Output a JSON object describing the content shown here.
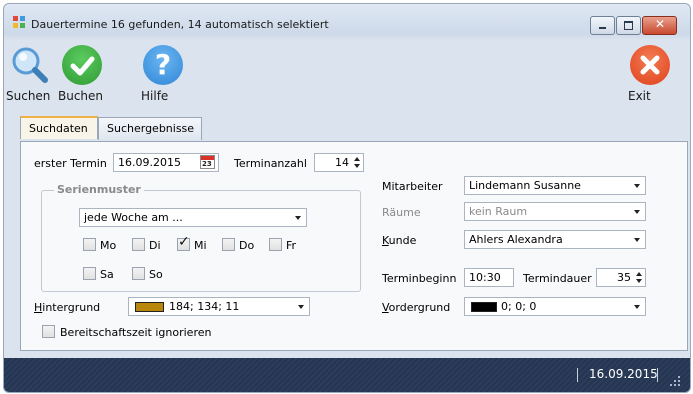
{
  "window": {
    "title": "Dauertermine 16 gefunden, 14 automatisch selektiert"
  },
  "toolbar": {
    "search_label": "Suchen",
    "book_label": "Buchen",
    "help_label": "Hilfe",
    "exit_label": "Exit"
  },
  "tabs": [
    {
      "label": "Suchdaten"
    },
    {
      "label": "Suchergebnisse"
    }
  ],
  "form": {
    "first_date_label": "erster Termin",
    "first_date_value": "16.09.2015",
    "count_label": "Terminanzahl",
    "count_value": "14",
    "series_group_title": "Serienmuster",
    "series_value": "jede Woche am ...",
    "weekdays": [
      {
        "label": "Mo",
        "checked": false
      },
      {
        "label": "Di",
        "checked": false
      },
      {
        "label": "Mi",
        "checked": true
      },
      {
        "label": "Do",
        "checked": false
      },
      {
        "label": "Fr",
        "checked": false
      },
      {
        "label": "Sa",
        "checked": false
      },
      {
        "label": "So",
        "checked": false
      }
    ],
    "background_label_first": "H",
    "background_label_rest": "intergrund",
    "background_value": "184; 134; 11",
    "background_color": "#b8860b",
    "ignore_label": "Bereitschaftszeit ignorieren",
    "employee_label": "Mitarbeiter",
    "employee_value": "Lindemann Susanne",
    "rooms_label": "Räume",
    "rooms_value": "kein Raum",
    "customer_label_first": "K",
    "customer_label_rest": "unde",
    "customer_value": "Ahlers Alexandra",
    "start_label": "Terminbeginn",
    "start_value": "10:30",
    "duration_label": "Termindauer",
    "duration_value": "35",
    "foreground_label_first": "V",
    "foreground_label_rest": "ordergrund",
    "foreground_value": "0; 0; 0",
    "foreground_color": "#000000"
  },
  "status": {
    "date": "16.09.2015"
  },
  "colors": {
    "search_icon": "#5a9bd5",
    "book_icon": "#2e9b33",
    "help_icon": "#2f86d6",
    "exit_icon": "#e0411c",
    "statusbar": "#27375a",
    "tab_accent": "#f0b14a"
  }
}
